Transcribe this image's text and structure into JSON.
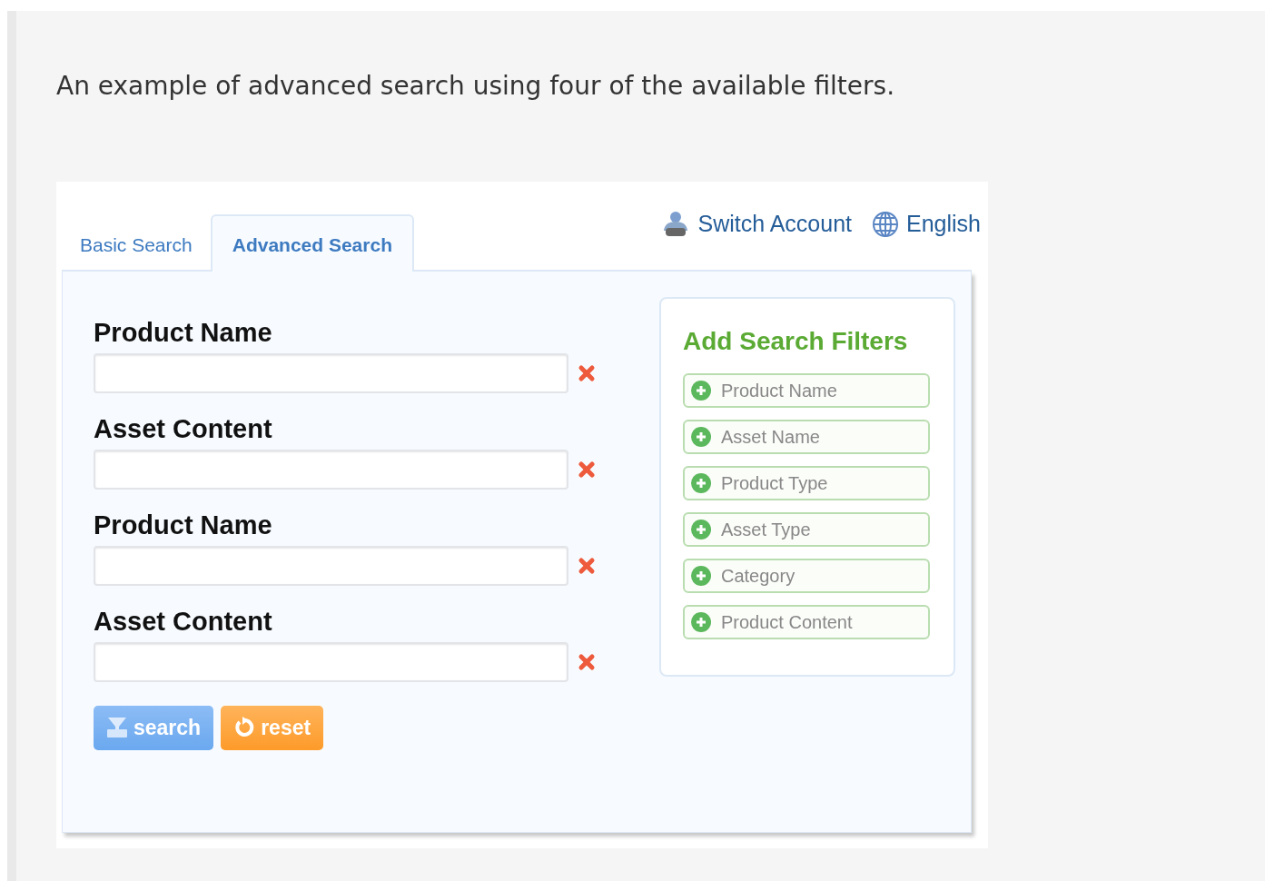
{
  "caption": "An example of advanced search using four of the available filters.",
  "tabs": [
    {
      "label": "Basic Search",
      "selected": false
    },
    {
      "label": "Advanced Search",
      "selected": true
    }
  ],
  "header_links": [
    {
      "kind": "account",
      "label": "Switch Account"
    },
    {
      "kind": "language",
      "label": "English"
    }
  ],
  "fields": [
    {
      "label": "Product Name"
    },
    {
      "label": "Asset Content"
    },
    {
      "label": "Product Name"
    },
    {
      "label": "Asset Content"
    }
  ],
  "buttons": [
    {
      "kind": "search",
      "label": "search"
    },
    {
      "kind": "reset",
      "label": "reset"
    }
  ],
  "filters_panel": {
    "title": "Add Search Filters",
    "items": [
      "Product Name",
      "Asset Name",
      "Product Type",
      "Asset Type",
      "Category",
      "Product Content"
    ]
  }
}
